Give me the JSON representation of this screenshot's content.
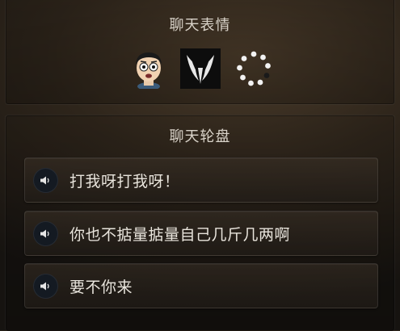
{
  "emoji_section": {
    "title": "聊天表情",
    "items": [
      {
        "icon": "cartoon-face-icon"
      },
      {
        "icon": "horned-logo-icon"
      },
      {
        "icon": "loading-spinner-icon"
      }
    ]
  },
  "wheel_section": {
    "title": "聊天轮盘",
    "phrases": [
      {
        "icon": "speaker-icon",
        "text": "打我呀打我呀！"
      },
      {
        "icon": "speaker-icon",
        "text": "你也不掂量掂量自己几斤几两啊"
      },
      {
        "icon": "speaker-icon",
        "text": "要不你来"
      }
    ]
  }
}
